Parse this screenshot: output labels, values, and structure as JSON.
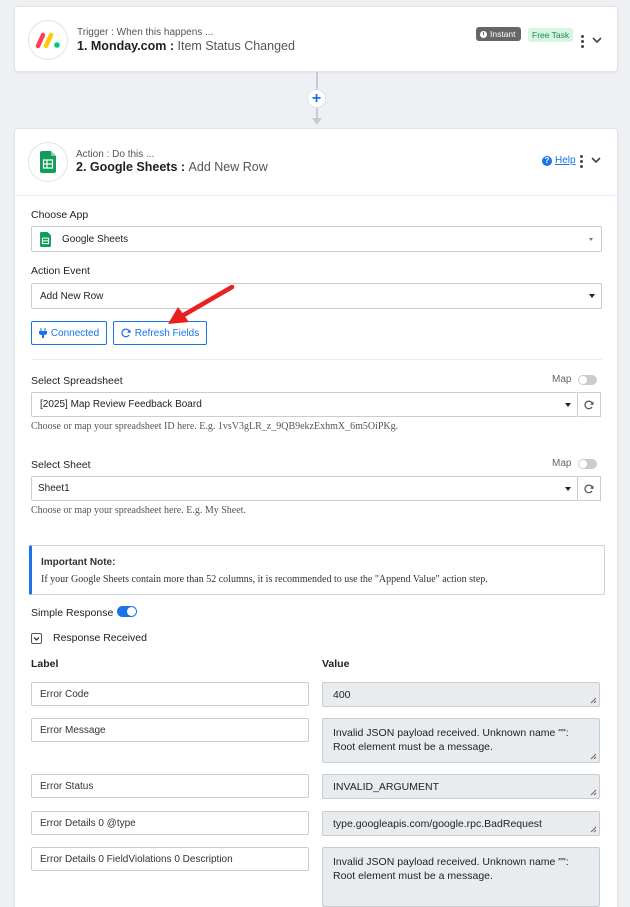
{
  "trigger": {
    "subtitle": "Trigger : When this happens ...",
    "app": "1. Monday.com :",
    "event": "Item Status Changed",
    "badge_instant": "Instant",
    "badge_free": "Free Task"
  },
  "action": {
    "subtitle": "Action : Do this ...",
    "app": "2. Google Sheets :",
    "event": "Add New Row",
    "help": "Help"
  },
  "form": {
    "choose_app_label": "Choose App",
    "choose_app_value": "Google Sheets",
    "action_event_label": "Action Event",
    "action_event_value": "Add New Row",
    "connected_btn": "Connected",
    "refresh_btn": "Refresh Fields",
    "spreadsheet_label": "Select Spreadsheet",
    "spreadsheet_value": "[2025] Map Review Feedback Board",
    "spreadsheet_hint": "Choose or map your spreadsheet ID here. E.g. 1vsV3gLR_z_9QB9ekzExhmX_6m5OiPKg.",
    "sheet_label": "Select Sheet",
    "sheet_value": "Sheet1",
    "sheet_hint": "Choose or map your spreadsheet here. E.g. My Sheet.",
    "map_label": "Map",
    "note_title": "Important Note:",
    "note_body": "If your Google Sheets contain more than 52 columns, it is recommended to use the \"Append Value\" action step.",
    "simple_response_label": "Simple Response",
    "response_received_label": "Response Received"
  },
  "response": {
    "label_header": "Label",
    "value_header": "Value",
    "rows": [
      {
        "label": "Error Code",
        "value": "400"
      },
      {
        "label": "Error Message",
        "value": "Invalid JSON payload received. Unknown name \"\": Root element must be a message."
      },
      {
        "label": "Error Status",
        "value": "INVALID_ARGUMENT"
      },
      {
        "label": "Error Details 0 @type",
        "value": "type.googleapis.com/google.rpc.BadRequest"
      },
      {
        "label": "Error Details 0 FieldViolations 0 Description",
        "value": "Invalid JSON payload received. Unknown name \"\": Root element must be a message."
      }
    ]
  },
  "colors": {
    "accent": "#1a73e8",
    "arrow": "#e8201f",
    "sheets_green": "#0f9d58"
  }
}
